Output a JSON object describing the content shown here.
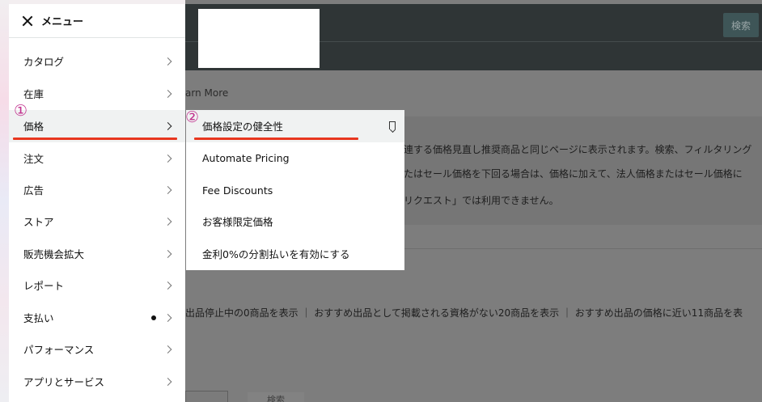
{
  "background": {
    "search_button": "検索",
    "learn_more": "arn More",
    "info_lines": [
      "連する価格見直し推奨商品と同じページに表示されます。検索、フィルタリング",
      "たはセール価格を下回る場合は、価格に加えて、法人価格またはセール価格に",
      "リクエスト」では利用できません。"
    ],
    "filters": "出品停止中の0商品を表示 ｜ おすすめ出品として掲載される資格がない20商品を表示 ｜ おすすめ出品の価格に近い11商品を表",
    "search_button_2": "検索"
  },
  "menu": {
    "title": "メニュー",
    "items": [
      {
        "label": "カタログ"
      },
      {
        "label": "在庫"
      },
      {
        "label": "価格"
      },
      {
        "label": "注文"
      },
      {
        "label": "広告"
      },
      {
        "label": "ストア"
      },
      {
        "label": "販売機会拡大"
      },
      {
        "label": "レポート"
      },
      {
        "label": "支払い"
      },
      {
        "label": "パフォーマンス"
      },
      {
        "label": "アプリとサービス"
      }
    ]
  },
  "submenu": {
    "items": [
      {
        "label": "価格設定の健全性"
      },
      {
        "label": "Automate Pricing"
      },
      {
        "label": "Fee Discounts"
      },
      {
        "label": "お客様限定価格"
      },
      {
        "label": "金利0%の分割払いを有効にする"
      }
    ]
  },
  "annotations": {
    "marker_1": "①",
    "marker_2": "②",
    "color": "#e8371f"
  }
}
